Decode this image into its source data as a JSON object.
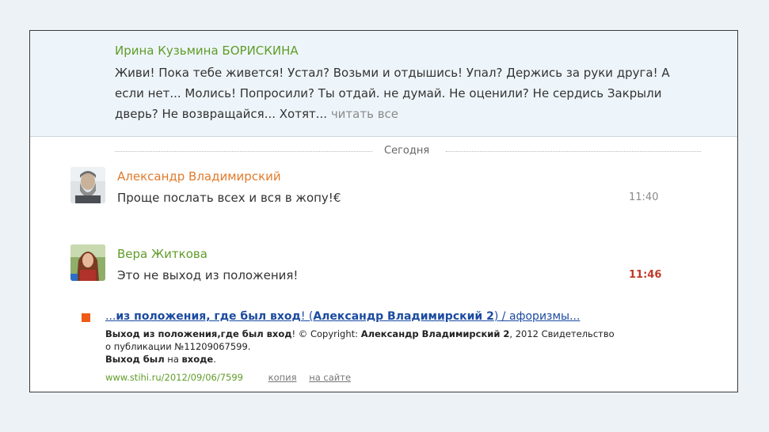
{
  "post": {
    "author": "Ирина Кузьмина БОРИСКИНА",
    "text": "Живи! Пока тебе живется! Устал? Возьми и отдышись! Упал? Держись за руки друга! А если нет... Молись! Попросили? Ты отдай. не думай. Не оценили? Не сердись Закрыли дверь? Не возвращайся... Хотят...",
    "read_more": "читать все"
  },
  "divider": {
    "label": "Сегодня"
  },
  "messages": [
    {
      "author": "Александр Владимирский",
      "author_color": "#e07b2c",
      "text": "Проще послать всех и вся в жопу!€",
      "time": "11:40",
      "time_color": "#8a8a8a"
    },
    {
      "author": "Вера Житкова",
      "author_color": "#5f9c28",
      "text": "Это не выход из положения!",
      "time": "11:46",
      "time_color": "#c0392b"
    }
  ],
  "search_result": {
    "title_lead": "...",
    "title_bold1": "из положения, где был вход",
    "title_mid1": "! (",
    "title_bold2": "Александр Владимирский 2",
    "title_tail": ") / афоризмы...",
    "snippet_b1": "Выход из положения,где был вход",
    "snippet_t1": "! © Copyright: ",
    "snippet_b2": "Александр Владимирский 2",
    "snippet_t2": ", 2012 Свидетельство о публикации №11209067599.",
    "snippet_b3": "Выход был",
    "snippet_t3": " на ",
    "snippet_b4": "входе",
    "snippet_t4": ".",
    "url": "www.stihi.ru/2012/09/06/7599",
    "copy_link": "копия",
    "site_link": "на сайте"
  },
  "colors": {
    "background": "#edf2f7",
    "post_bg": "#eef5fa",
    "green": "#5f9c28",
    "orange": "#e07b2c",
    "link": "#1b4ba0",
    "bullet": "#ee5b16"
  },
  "icons": {
    "avatar_1": "man-with-beard-avatar",
    "avatar_2": "woman-avatar",
    "bullet": "orange-square-bullet"
  }
}
